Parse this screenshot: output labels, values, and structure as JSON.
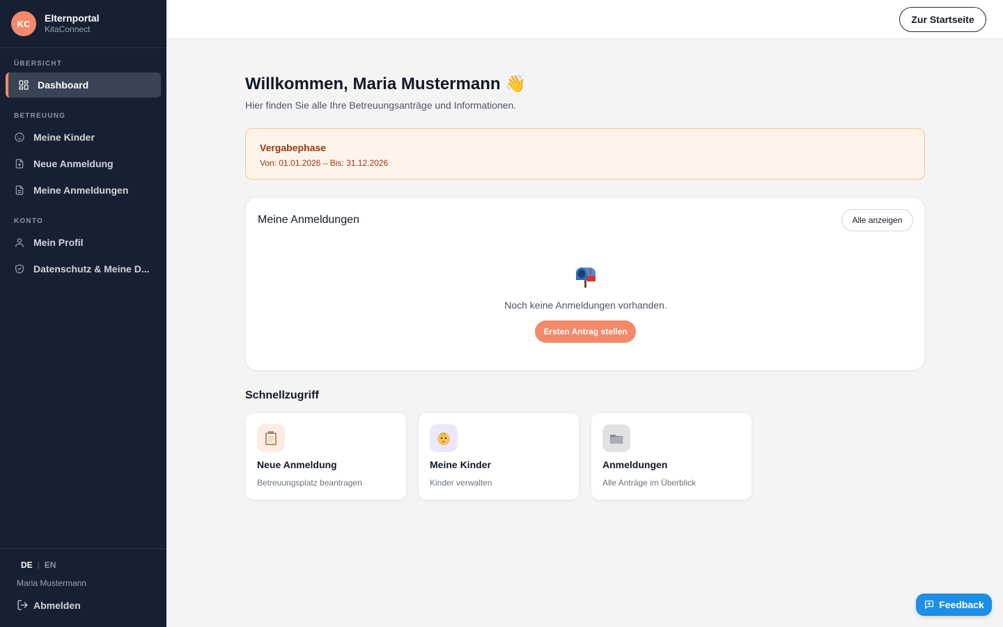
{
  "brand": {
    "initials": "KC",
    "title": "Elternportal",
    "subtitle": "KitaConnect"
  },
  "sidebar": {
    "sections": [
      "ÜBERSICHT",
      "BETREUUNG",
      "KONTO"
    ],
    "items": [
      {
        "label": "Dashboard",
        "icon": "grid-icon",
        "active": true
      },
      {
        "label": "Meine Kinder",
        "icon": "smile-icon"
      },
      {
        "label": "Neue Anmeldung",
        "icon": "file-plus-icon"
      },
      {
        "label": "Meine Anmeldungen",
        "icon": "file-text-icon"
      },
      {
        "label": "Mein Profil",
        "icon": "user-icon"
      },
      {
        "label": "Datenschutz & Meine D...",
        "icon": "shield-icon"
      }
    ],
    "lang": {
      "de": "DE",
      "sep": "|",
      "en": "EN"
    },
    "user_name": "Maria Mustermann",
    "logout_label": "Abmelden"
  },
  "topbar": {
    "home_label": "Zur Startseite"
  },
  "main": {
    "welcome": "Willkommen, Maria Mustermann 👋",
    "subtitle": "Hier finden Sie alle Ihre Betreuungsanträge und Informationen.",
    "phase": {
      "title": "Vergabephase",
      "dates": "Von: 01.01.2026 – Bis: 31.12.2026"
    },
    "registrations": {
      "title": "Meine Anmeldungen",
      "all_label": "Alle anzeigen",
      "empty_text": "Noch keine Anmeldungen vorhanden.",
      "cta_label": "Ersten Antrag stellen"
    },
    "quick": {
      "title": "Schnellzugriff",
      "tiles": [
        {
          "title": "Neue Anmeldung",
          "subtitle": "Betreuungsplatz beantragen",
          "icon": "clipboard-icon",
          "bg": "#fdece6"
        },
        {
          "title": "Meine Kinder",
          "subtitle": "Kinder verwalten",
          "icon": "baby-icon",
          "bg": "#ebe8fb"
        },
        {
          "title": "Anmeldungen",
          "subtitle": "Alle Anträge im Überblick",
          "icon": "folder-icon",
          "bg": "#e1e2e4"
        }
      ]
    }
  },
  "feedback_label": "Feedback",
  "colors": {
    "accent": "#f3896a",
    "sidebar": "#172033",
    "feedback": "#1d8fe6",
    "warning_bg": "#fff4ea"
  }
}
